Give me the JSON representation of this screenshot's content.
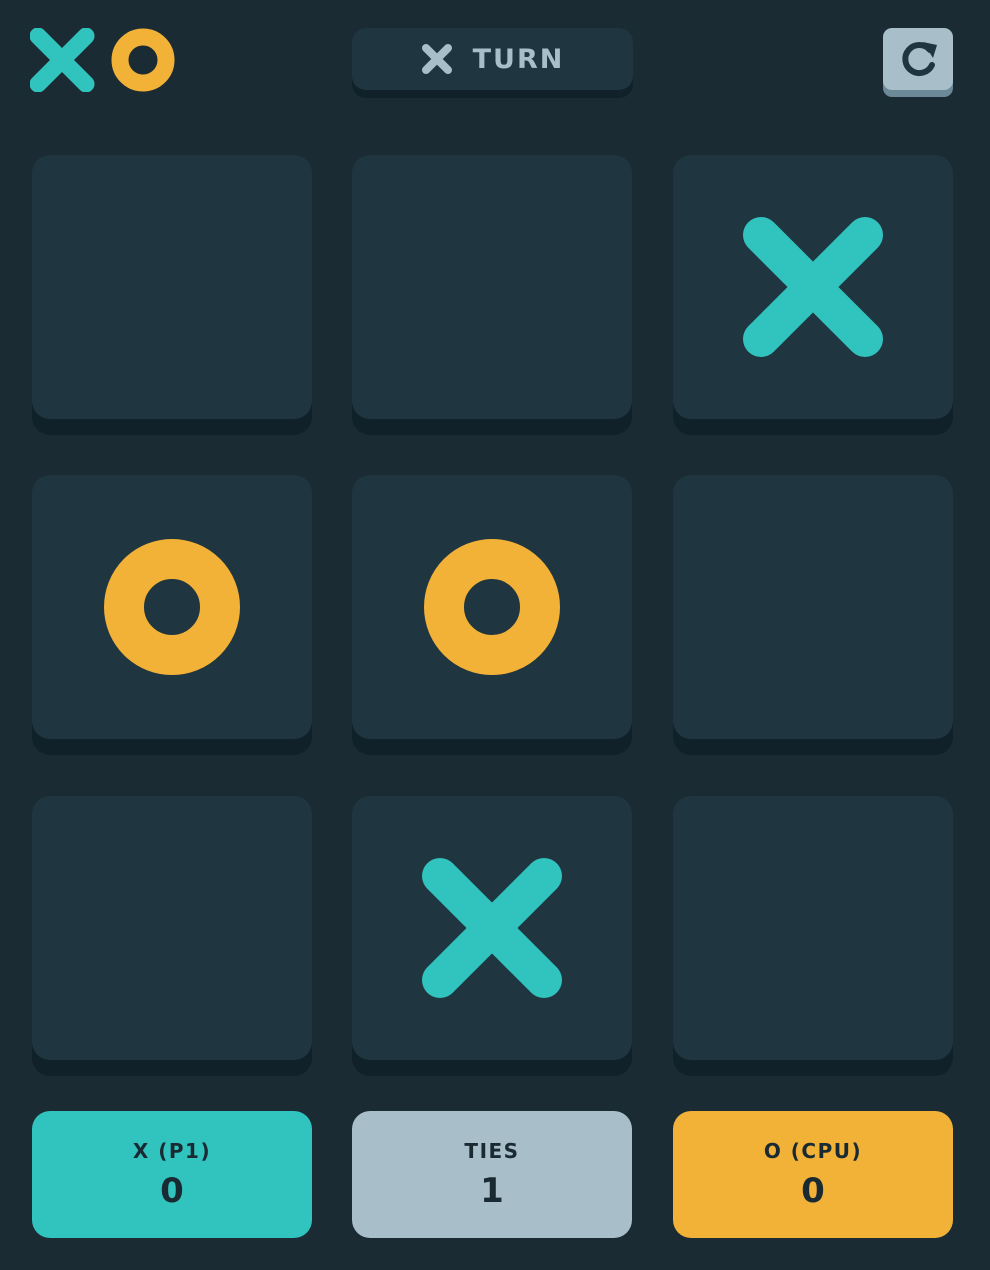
{
  "colors": {
    "background": "#1b2b33",
    "tile": "#1f3540",
    "tile_shadow": "#10212a",
    "x": "#31c4be",
    "o": "#f2b137",
    "silver": "#a8bec9"
  },
  "header": {
    "logo_icons": [
      "x-icon",
      "o-icon"
    ],
    "turn": {
      "player_icon": "x-icon",
      "label": "TURN"
    },
    "restart_icon": "restart-icon"
  },
  "board": {
    "cells": [
      "",
      "",
      "X",
      "O",
      "O",
      "",
      "",
      "X",
      ""
    ]
  },
  "scores": {
    "x": {
      "label": "X (P1)",
      "value": "0"
    },
    "ties": {
      "label": "TIES",
      "value": "1"
    },
    "o": {
      "label": "O (CPU)",
      "value": "0"
    }
  }
}
